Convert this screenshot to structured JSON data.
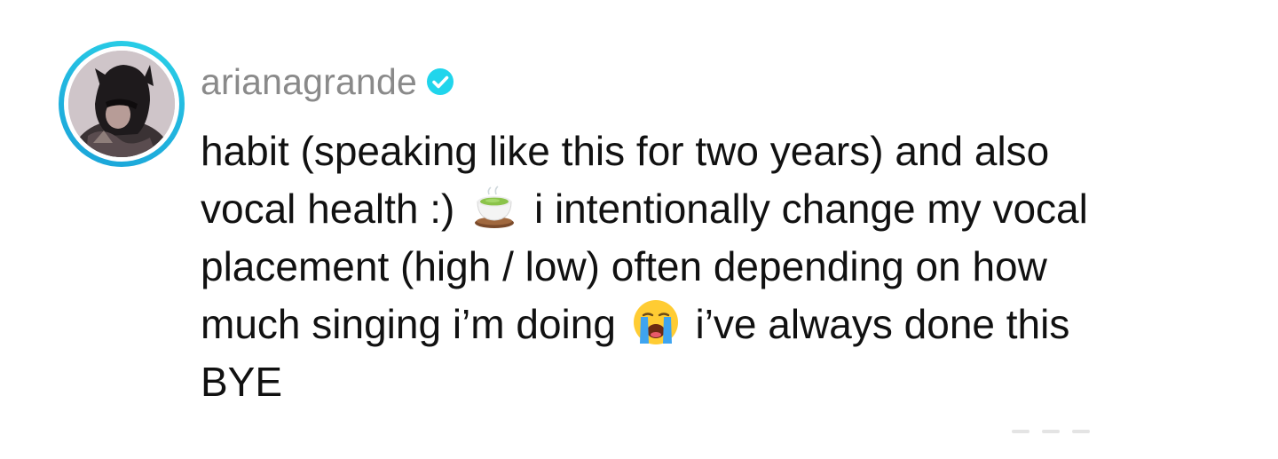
{
  "comment": {
    "username": "arianagrande",
    "verified": true,
    "avatar_icon": "profile-photo",
    "avatar_ring_color": "#23b8e0",
    "verified_badge_color": "#20d5ec",
    "text_lines": {
      "line1": "habit (speaking like this for two years) and also",
      "line2a": "vocal health :)",
      "line2b": "i intentionally change my vocal",
      "line3": "placement (high / low) often depending on how",
      "line4a": "much singing i’m doing",
      "line4b": "i’ve always done this",
      "line5": "BYE"
    },
    "emojis": [
      "green-tea-icon",
      "loudly-crying-face-icon"
    ]
  }
}
